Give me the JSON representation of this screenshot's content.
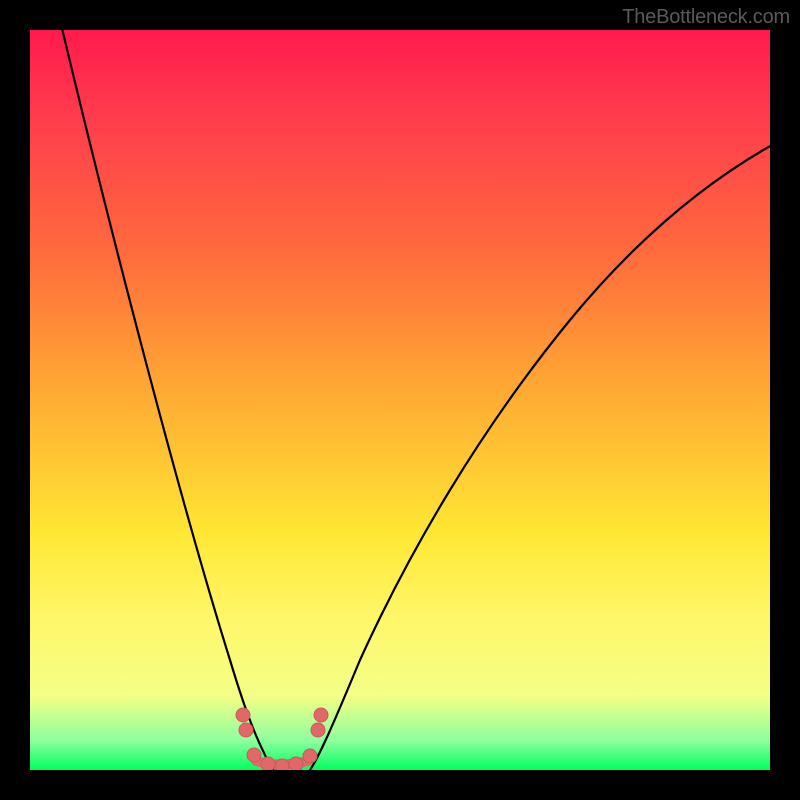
{
  "watermark": "TheBottleneck.com",
  "chart_data": {
    "type": "line",
    "title": "",
    "xlabel": "",
    "ylabel": "",
    "xlim": [
      0,
      1
    ],
    "ylim": [
      0,
      1
    ],
    "series": [
      {
        "name": "left-curve",
        "x": [
          0.05,
          0.1,
          0.15,
          0.2,
          0.25,
          0.28,
          0.3,
          0.32
        ],
        "y": [
          1.0,
          0.78,
          0.56,
          0.35,
          0.15,
          0.06,
          0.03,
          0.01
        ]
      },
      {
        "name": "right-curve",
        "x": [
          0.38,
          0.42,
          0.5,
          0.6,
          0.7,
          0.8,
          0.9,
          1.0
        ],
        "y": [
          0.01,
          0.05,
          0.2,
          0.38,
          0.52,
          0.63,
          0.72,
          0.8
        ]
      }
    ],
    "markers": {
      "name": "threshold-dots",
      "x": [
        0.29,
        0.29,
        0.31,
        0.33,
        0.35,
        0.37,
        0.38,
        0.38
      ],
      "y": [
        0.1,
        0.08,
        0.02,
        0.01,
        0.01,
        0.02,
        0.08,
        0.1
      ]
    },
    "background_gradient": [
      "#ff1a4d",
      "#ff6a3d",
      "#ffe733",
      "#00ff5f"
    ]
  }
}
